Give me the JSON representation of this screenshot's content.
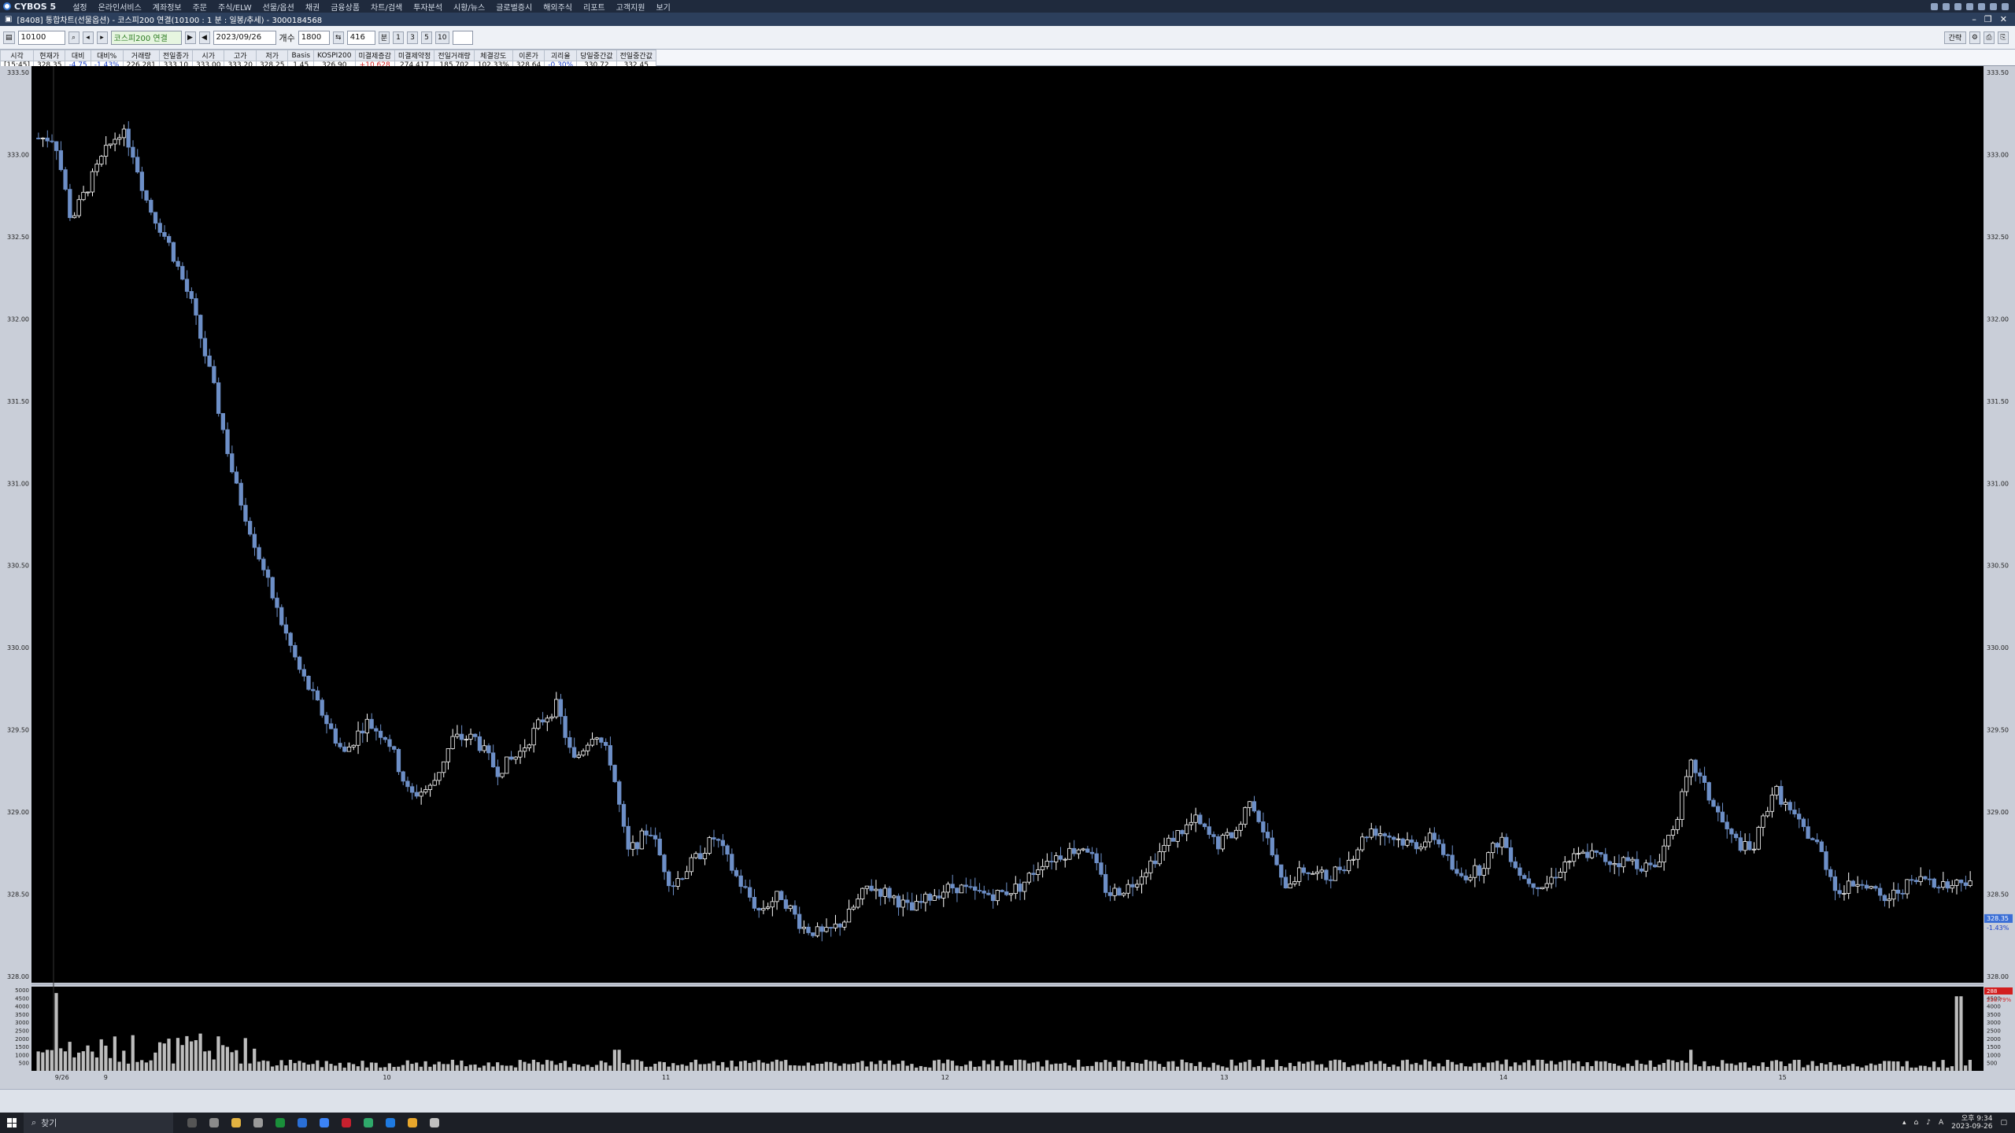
{
  "app": {
    "brand": "CYBOS 5",
    "menu": [
      "설정",
      "온라인서비스",
      "계좌정보",
      "주문",
      "주식/ELW",
      "선물/옵션",
      "채권",
      "금융상품",
      "차트/검색",
      "투자분석",
      "시황/뉴스",
      "글로벌증시",
      "해외주식",
      "리포트",
      "고객지원",
      "보기"
    ]
  },
  "window": {
    "title": "[8408] 통합차트(선물옵션) - 코스피200 연결(10100 : 1 분 : 일봉/추세) - 3000184568"
  },
  "toolbar": {
    "code": "10100",
    "name": "코스피200 연결",
    "date": "2023/09/26",
    "interval_label": "개수",
    "count": "1800",
    "period": "416",
    "period_buttons": [
      "1",
      "3",
      "5",
      "10"
    ],
    "menu_label": "분",
    "right_label": "간략"
  },
  "quote": {
    "headers": [
      "시각",
      "현재가",
      "대비",
      "대비%",
      "거래량",
      "전일종가",
      "시가",
      "고가",
      "저가",
      "Basis",
      "KOSPI200",
      "미결제증감",
      "미결제약정",
      "전일거래량",
      "체결강도",
      "이론가",
      "괴리율",
      "당일중간값",
      "전일중간값"
    ],
    "values": [
      "[15:45]",
      "328.35",
      "-4.75",
      "-1.43%",
      "226,281",
      "333.10",
      "333.00",
      "333.20",
      "328.25",
      "1.45",
      "326.90",
      "+10,628",
      "274,417",
      "185,702",
      "102.33%",
      "328.64",
      "-0.30%",
      "330.72",
      "332.45"
    ]
  },
  "chart_data": {
    "type": "candlestick",
    "price_axis": {
      "min": 328.0,
      "max": 333.5,
      "ticks": [
        "333.50",
        "333.00",
        "332.50",
        "332.00",
        "331.50",
        "331.00",
        "330.50",
        "330.00",
        "329.50",
        "329.00",
        "328.50",
        "328.00"
      ]
    },
    "volume_axis": {
      "max": 5000,
      "ticks": [
        "5000",
        "4500",
        "4000",
        "3500",
        "3000",
        "2500",
        "2000",
        "1500",
        "1000",
        "500"
      ]
    },
    "x_labels": [
      "9/26",
      "9",
      "10",
      "11",
      "12",
      "13",
      "14",
      "15"
    ],
    "current_price": "328.35",
    "current_pct": "-1.43%",
    "current_volume": "288",
    "current_volume_pct": "258.79%",
    "price_path": [
      {
        "t": 0,
        "p": 333.1
      },
      {
        "t": 3,
        "p": 333.1
      },
      {
        "t": 6,
        "p": 332.6
      },
      {
        "t": 9,
        "p": 332.8
      },
      {
        "t": 12,
        "p": 333.0
      },
      {
        "t": 15,
        "p": 333.15
      },
      {
        "t": 17,
        "p": 333.05
      },
      {
        "t": 20,
        "p": 332.7
      },
      {
        "t": 24,
        "p": 332.45
      },
      {
        "t": 28,
        "p": 332.1
      },
      {
        "t": 32,
        "p": 331.6
      },
      {
        "t": 36,
        "p": 331.0
      },
      {
        "t": 40,
        "p": 330.6
      },
      {
        "t": 44,
        "p": 330.2
      },
      {
        "t": 48,
        "p": 329.85
      },
      {
        "t": 52,
        "p": 329.6
      },
      {
        "t": 56,
        "p": 329.35
      },
      {
        "t": 60,
        "p": 329.55
      },
      {
        "t": 64,
        "p": 329.45
      },
      {
        "t": 68,
        "p": 329.1
      },
      {
        "t": 72,
        "p": 329.15
      },
      {
        "t": 76,
        "p": 329.45
      },
      {
        "t": 80,
        "p": 329.45
      },
      {
        "t": 84,
        "p": 329.25
      },
      {
        "t": 88,
        "p": 329.35
      },
      {
        "t": 92,
        "p": 329.55
      },
      {
        "t": 95,
        "p": 329.65
      },
      {
        "t": 98,
        "p": 329.3
      },
      {
        "t": 102,
        "p": 329.5
      },
      {
        "t": 105,
        "p": 329.3
      },
      {
        "t": 108,
        "p": 328.75
      },
      {
        "t": 112,
        "p": 328.9
      },
      {
        "t": 116,
        "p": 328.55
      },
      {
        "t": 120,
        "p": 328.7
      },
      {
        "t": 124,
        "p": 328.85
      },
      {
        "t": 128,
        "p": 328.6
      },
      {
        "t": 132,
        "p": 328.4
      },
      {
        "t": 136,
        "p": 328.5
      },
      {
        "t": 140,
        "p": 328.3
      },
      {
        "t": 144,
        "p": 328.25
      },
      {
        "t": 148,
        "p": 328.35
      },
      {
        "t": 152,
        "p": 328.55
      },
      {
        "t": 156,
        "p": 328.5
      },
      {
        "t": 160,
        "p": 328.4
      },
      {
        "t": 164,
        "p": 328.5
      },
      {
        "t": 168,
        "p": 328.55
      },
      {
        "t": 172,
        "p": 328.5
      },
      {
        "t": 176,
        "p": 328.5
      },
      {
        "t": 180,
        "p": 328.55
      },
      {
        "t": 184,
        "p": 328.7
      },
      {
        "t": 188,
        "p": 328.75
      },
      {
        "t": 192,
        "p": 328.8
      },
      {
        "t": 196,
        "p": 328.5
      },
      {
        "t": 200,
        "p": 328.55
      },
      {
        "t": 204,
        "p": 328.7
      },
      {
        "t": 208,
        "p": 328.85
      },
      {
        "t": 212,
        "p": 328.95
      },
      {
        "t": 216,
        "p": 328.8
      },
      {
        "t": 220,
        "p": 328.9
      },
      {
        "t": 222,
        "p": 329.1
      },
      {
        "t": 225,
        "p": 328.85
      },
      {
        "t": 228,
        "p": 328.55
      },
      {
        "t": 232,
        "p": 328.65
      },
      {
        "t": 236,
        "p": 328.6
      },
      {
        "t": 240,
        "p": 328.7
      },
      {
        "t": 244,
        "p": 328.9
      },
      {
        "t": 248,
        "p": 328.85
      },
      {
        "t": 252,
        "p": 328.8
      },
      {
        "t": 256,
        "p": 328.85
      },
      {
        "t": 260,
        "p": 328.6
      },
      {
        "t": 264,
        "p": 328.65
      },
      {
        "t": 268,
        "p": 328.85
      },
      {
        "t": 272,
        "p": 328.6
      },
      {
        "t": 276,
        "p": 328.55
      },
      {
        "t": 280,
        "p": 328.7
      },
      {
        "t": 284,
        "p": 328.75
      },
      {
        "t": 288,
        "p": 328.7
      },
      {
        "t": 292,
        "p": 328.7
      },
      {
        "t": 296,
        "p": 328.65
      },
      {
        "t": 300,
        "p": 328.95
      },
      {
        "t": 303,
        "p": 329.3
      },
      {
        "t": 306,
        "p": 329.1
      },
      {
        "t": 310,
        "p": 328.85
      },
      {
        "t": 314,
        "p": 328.75
      },
      {
        "t": 318,
        "p": 329.15
      },
      {
        "t": 322,
        "p": 328.95
      },
      {
        "t": 326,
        "p": 328.8
      },
      {
        "t": 330,
        "p": 328.5
      },
      {
        "t": 334,
        "p": 328.6
      },
      {
        "t": 338,
        "p": 328.45
      },
      {
        "t": 342,
        "p": 328.55
      },
      {
        "t": 346,
        "p": 328.6
      },
      {
        "t": 350,
        "p": 328.55
      },
      {
        "t": 354,
        "p": 328.6
      }
    ],
    "volume_spikes": [
      {
        "t": 3,
        "v": 4800
      },
      {
        "t": 17,
        "v": 2200
      },
      {
        "t": 30,
        "v": 2300
      },
      {
        "t": 106,
        "v": 1300
      },
      {
        "t": 303,
        "v": 1300
      },
      {
        "t": 352,
        "v": 4600
      }
    ]
  },
  "taskbar": {
    "search_label": "찾기",
    "time": "오후 9:34",
    "date": "2023-09-26"
  },
  "colors": {
    "chart_bg": "#000000",
    "candle_up": "#ffffff",
    "candle_down": "#6d8fc7",
    "volume_bar": "#bdbdbd"
  }
}
